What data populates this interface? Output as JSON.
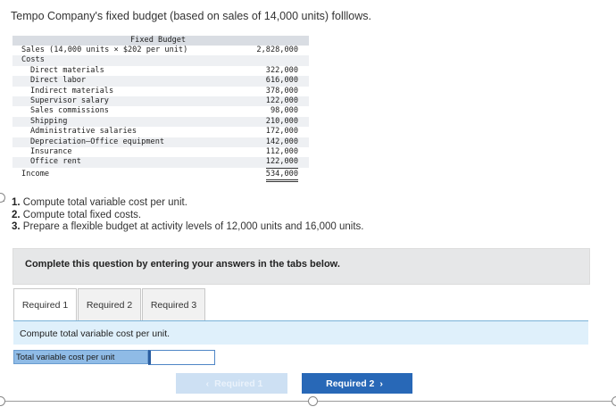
{
  "intro": "Tempo Company's fixed budget (based on sales of 14,000 units) folllows.",
  "budget": {
    "header": "Fixed Budget",
    "sales_label": "Sales (14,000 units × $202 per unit)",
    "sales_value": "2,828,000",
    "costs_label": "Costs",
    "costs": [
      {
        "label": "Direct materials",
        "value": "322,000"
      },
      {
        "label": "Direct labor",
        "value": "616,000"
      },
      {
        "label": "Indirect materials",
        "value": "378,000"
      },
      {
        "label": "Supervisor salary",
        "value": "122,000"
      },
      {
        "label": "Sales commissions",
        "value": "98,000"
      },
      {
        "label": "Shipping",
        "value": "210,000"
      },
      {
        "label": "Administrative salaries",
        "value": "172,000"
      },
      {
        "label": "Depreciation—Office equipment",
        "value": "142,000"
      },
      {
        "label": "Insurance",
        "value": "112,000"
      },
      {
        "label": "Office rent",
        "value": "122,000"
      }
    ],
    "income_label": "Income",
    "income_value": "534,000"
  },
  "requirements": [
    {
      "num": "1.",
      "text": "Compute total variable cost per unit."
    },
    {
      "num": "2.",
      "text": "Compute total fixed costs."
    },
    {
      "num": "3.",
      "text": "Prepare a flexible budget at activity levels of 12,000 units and 16,000 units."
    }
  ],
  "complete_text": "Complete this question by entering your answers in the tabs below.",
  "tabs": [
    "Required 1",
    "Required 2",
    "Required 3"
  ],
  "prompt": "Compute total variable cost per unit.",
  "answer": {
    "label": "Total variable cost per unit",
    "value": ""
  },
  "buttons": {
    "prev": "Required 1",
    "next": "Required 2"
  },
  "icons": {
    "prev": "chevron-left-icon",
    "next": "chevron-right-icon"
  },
  "colors": {
    "accent": "#2868b7",
    "prompt_bg": "#dff0fb",
    "answer_label_bg": "#8fbbe6"
  }
}
